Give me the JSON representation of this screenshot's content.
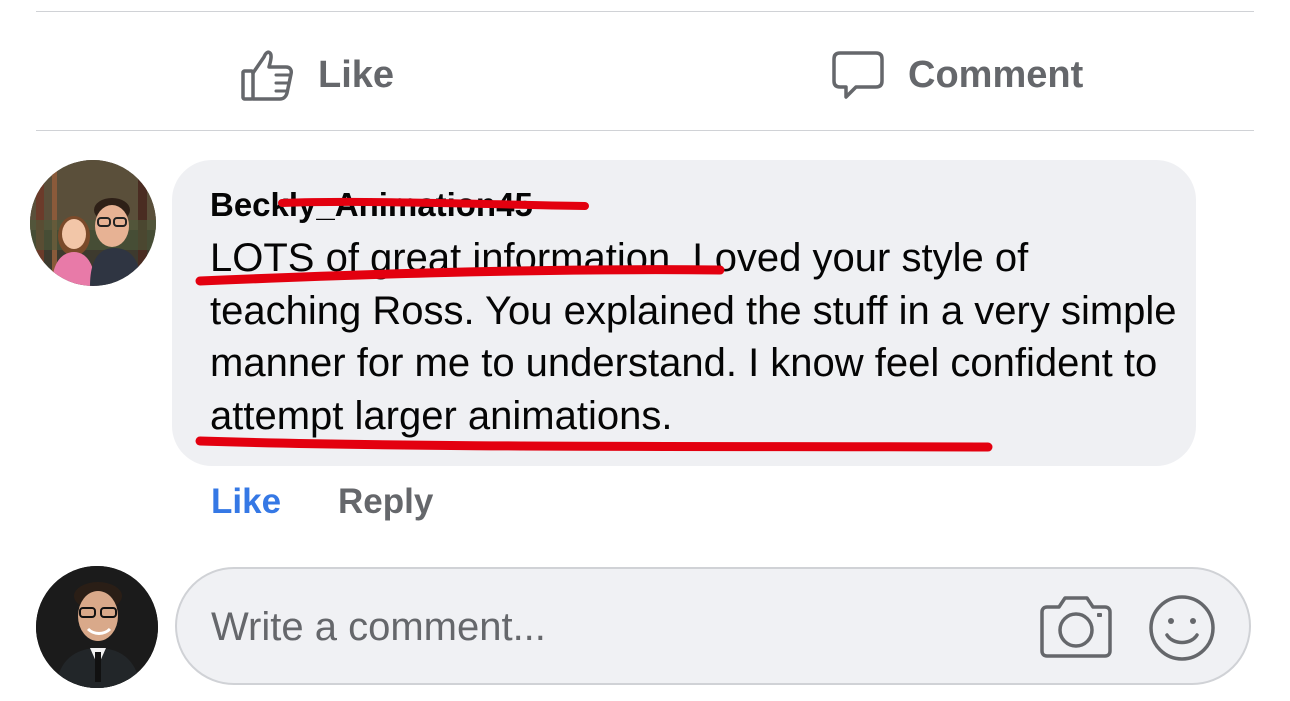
{
  "post_actions": {
    "like_label": "Like",
    "comment_label": "Comment",
    "like_icon": "thumbs-up-icon",
    "comment_icon": "speech-bubble-icon"
  },
  "comment": {
    "author": "Beckly_Animation45",
    "text": "LOTS of great information. Loved your style of teaching Ross. You explained the stuff in a very simple manner for me to understand. I know feel confident to attempt larger animations.",
    "actions": {
      "like": "Like",
      "reply": "Reply"
    }
  },
  "composer": {
    "placeholder": "Write a comment...",
    "camera_icon": "camera-icon",
    "emoji_icon": "smiley-icon"
  },
  "colors": {
    "like_blue": "#3578e5",
    "secondary_text": "#65676b",
    "bubble_bg": "#eff0f3",
    "red_annotation": "#e3000f"
  }
}
